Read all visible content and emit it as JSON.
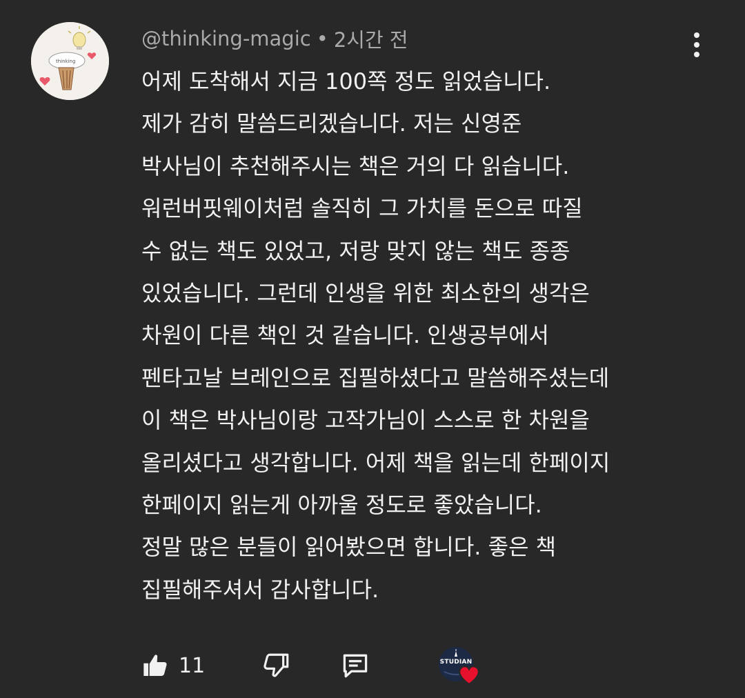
{
  "comment": {
    "author": "@thinking-magic",
    "separator": "•",
    "timestamp": "2시간 전",
    "lines": [
      "어제 도착해서 지금 100쪽 정도 읽었습니다.",
      "제가 감히 말씀드리겠습니다. 저는 신영준",
      "박사님이 추천해주시는 책은 거의 다 읽습니다.",
      "워런버핏웨이처럼 솔직히 그 가치를 돈으로 따질",
      "수 없는 책도 있었고, 저랑 맞지 않는 책도 종종",
      "있었습니다. 그런데 인생을 위한 최소한의 생각은",
      "차원이 다른 책인 것 같습니다. 인생공부에서",
      "펜타고날 브레인으로 집필하셨다고 말씀해주셨는데",
      "이 책은 박사님이랑 고작가님이 스스로 한 차원을",
      "올리셨다고 생각합니다. 어제 책을 읽는데 한페이지",
      "한페이지 읽는게 아까울 정도로 좋았습니다.",
      "정말 많은 분들이 읽어봤으면 합니다. 좋은 책",
      "집필해주셔서 감사합니다."
    ]
  },
  "actions": {
    "like_count": "11",
    "like_icon": "thumbs-up-icon",
    "dislike_icon": "thumbs-down-icon",
    "reply_icon": "reply-comment-icon",
    "creator_avatar_text": "STUDIAN",
    "creator_heart_icon": "heart-icon"
  },
  "colors": {
    "background": "#282828",
    "text": "#f1f1f1",
    "meta_text": "#aaaaaa",
    "heart": "#e8112d"
  }
}
